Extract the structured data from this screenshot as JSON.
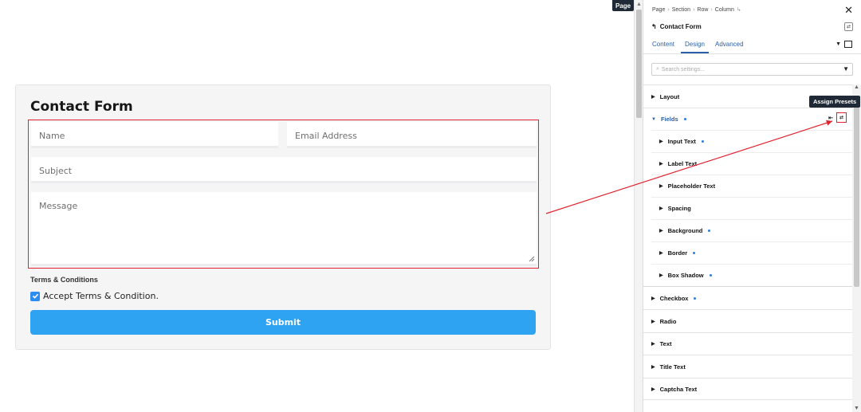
{
  "canvas": {
    "page_tag": "Page",
    "form": {
      "title": "Contact Form",
      "fields": {
        "name_placeholder": "Name",
        "email_placeholder": "Email Address",
        "subject_placeholder": "Subject",
        "message_placeholder": "Message"
      },
      "terms_label": "Terms & Conditions",
      "terms_checkbox_text": "Accept Terms & Condition.",
      "terms_checked": true,
      "submit_label": "Submit",
      "submit_color": "#2ea3f2"
    }
  },
  "panel": {
    "breadcrumb": [
      "Page",
      "Section",
      "Row",
      "Column"
    ],
    "title": "Contact Form",
    "tabs": [
      {
        "label": "Content",
        "active": false
      },
      {
        "label": "Design",
        "active": true
      },
      {
        "label": "Advanced",
        "active": false
      }
    ],
    "search_placeholder": "Search settings...",
    "sections": [
      {
        "label": "Layout",
        "expanded": false,
        "modified": false
      },
      {
        "label": "Fields",
        "expanded": true,
        "modified": true
      },
      {
        "label": "Checkbox",
        "expanded": false,
        "modified": true
      },
      {
        "label": "Radio",
        "expanded": false,
        "modified": false
      },
      {
        "label": "Text",
        "expanded": false,
        "modified": false
      },
      {
        "label": "Title Text",
        "expanded": false,
        "modified": false
      },
      {
        "label": "Captcha Text",
        "expanded": false,
        "modified": false
      }
    ],
    "field_subsections": [
      {
        "label": "Input Text",
        "modified": true
      },
      {
        "label": "Label Text",
        "modified": false
      },
      {
        "label": "Placeholder Text",
        "modified": false
      },
      {
        "label": "Spacing",
        "modified": false
      },
      {
        "label": "Background",
        "modified": true
      },
      {
        "label": "Border",
        "modified": true
      },
      {
        "label": "Box Shadow",
        "modified": true
      }
    ],
    "tooltip": "Assign Presets"
  },
  "colors": {
    "accent_blue": "#2b5fa8",
    "highlight_red": "#e0242f",
    "modified_dot": "#2d7fe0"
  }
}
